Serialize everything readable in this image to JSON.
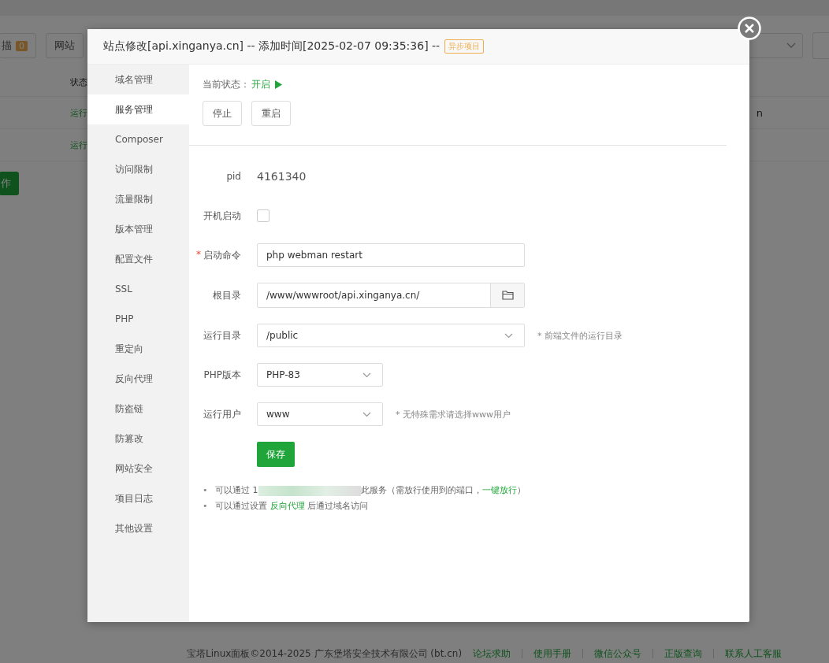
{
  "background": {
    "scan_button": {
      "label": "描",
      "count": "0"
    },
    "site_button": "网站",
    "table_header": "状态",
    "rows": [
      {
        "status": "运行",
        "domain": "n"
      },
      {
        "status": "运行",
        "domain": ""
      }
    ],
    "action_button": "作"
  },
  "footer": {
    "copyright": "宝塔Linux面板©2014-2025 广东堡塔安全技术有限公司 (bt.cn)",
    "links": [
      "论坛求助",
      "使用手册",
      "微信公众号",
      "正版查询",
      "联系人工客服"
    ]
  },
  "dialog": {
    "title": "站点修改[api.xinganya.cn] -- 添加时间[2025-02-07 09:35:36] --",
    "badge": "异步项目",
    "menu": [
      {
        "label": "域名管理",
        "selected": false
      },
      {
        "label": "服务管理",
        "selected": true
      },
      {
        "label": "Composer",
        "selected": false
      },
      {
        "label": "访问限制",
        "selected": false
      },
      {
        "label": "流量限制",
        "selected": false
      },
      {
        "label": "版本管理",
        "selected": false
      },
      {
        "label": "配置文件",
        "selected": false
      },
      {
        "label": "SSL",
        "selected": false
      },
      {
        "label": "PHP",
        "selected": false
      },
      {
        "label": "重定向",
        "selected": false
      },
      {
        "label": "反向代理",
        "selected": false
      },
      {
        "label": "防盗链",
        "selected": false
      },
      {
        "label": "防篡改",
        "selected": false
      },
      {
        "label": "网站安全",
        "selected": false
      },
      {
        "label": "项目日志",
        "selected": false
      },
      {
        "label": "其他设置",
        "selected": false
      }
    ],
    "status_label": "当前状态：",
    "status_value": "开启",
    "running": true,
    "buttons": [
      "停止",
      "重启"
    ],
    "fields": [
      {
        "kind": "text",
        "label": "pid",
        "value": "4161340"
      },
      {
        "kind": "checkbox",
        "label": "开机启动",
        "checked": false
      },
      {
        "kind": "input",
        "label": "启动命令",
        "required_mark": "*",
        "value": "php webman restart"
      },
      {
        "kind": "path",
        "label": "根目录",
        "value": "/www/wwwroot/api.xinganya.cn/"
      },
      {
        "kind": "select",
        "label": "运行目录",
        "value": "/public",
        "wide": true,
        "hint": "* 前端文件的运行目录"
      },
      {
        "kind": "select",
        "label": "PHP版本",
        "value": "PHP-83",
        "wide": false
      },
      {
        "kind": "select",
        "label": "运行用户",
        "value": "www",
        "wide": false,
        "hint": "* 无特殊需求请选择www用户"
      }
    ],
    "save": "保存",
    "notes": [
      {
        "bullet": "•",
        "parts": [
          {
            "kind": "text",
            "text": "可以通过 1"
          },
          {
            "kind": "redacted"
          },
          {
            "kind": "text",
            "text": "此服务（需放行使用到的端口，"
          },
          {
            "kind": "link",
            "text": "一键放行"
          },
          {
            "kind": "text",
            "text": "）"
          }
        ]
      },
      {
        "bullet": "•",
        "parts": [
          {
            "kind": "text",
            "text": "可以通过设置 "
          },
          {
            "kind": "link",
            "text": "反向代理"
          },
          {
            "kind": "text",
            "text": " 后通过域名访问"
          }
        ]
      }
    ]
  }
}
